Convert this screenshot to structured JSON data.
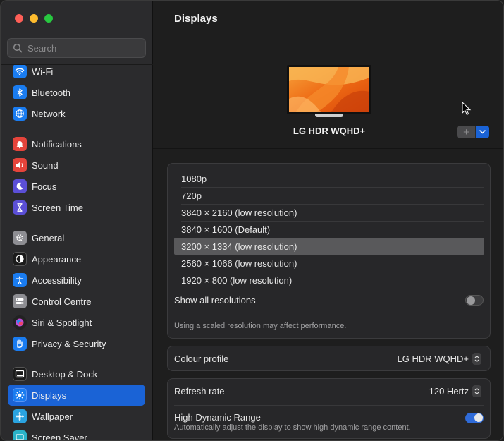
{
  "search": {
    "placeholder": "Search"
  },
  "sidebar": {
    "items": [
      {
        "label": "Wi-Fi",
        "icon": "wifi-icon",
        "color": "#1a7cf0"
      },
      {
        "label": "Bluetooth",
        "icon": "bluetooth-icon",
        "color": "#1a7cf0"
      },
      {
        "label": "Network",
        "icon": "globe-icon",
        "color": "#1a7cf0"
      },
      {
        "label": "Notifications",
        "icon": "bell-icon",
        "color": "#e5443b"
      },
      {
        "label": "Sound",
        "icon": "speaker-icon",
        "color": "#e5443b"
      },
      {
        "label": "Focus",
        "icon": "moon-icon",
        "color": "#5b4fd6"
      },
      {
        "label": "Screen Time",
        "icon": "hourglass-icon",
        "color": "#5b4fd6"
      },
      {
        "label": "General",
        "icon": "gear-icon",
        "color": "#8e8e93"
      },
      {
        "label": "Appearance",
        "icon": "appearance-icon",
        "color": "#1b1b1b"
      },
      {
        "label": "Accessibility",
        "icon": "accessibility-icon",
        "color": "#1a7cf0"
      },
      {
        "label": "Control Centre",
        "icon": "control-centre-icon",
        "color": "#8e8e93"
      },
      {
        "label": "Siri & Spotlight",
        "icon": "siri-icon",
        "color": "#222222"
      },
      {
        "label": "Privacy & Security",
        "icon": "hand-icon",
        "color": "#1a7cf0"
      },
      {
        "label": "Desktop & Dock",
        "icon": "dock-icon",
        "color": "#1b1b1b"
      },
      {
        "label": "Displays",
        "icon": "sun-icon",
        "color": "#1a7cf0",
        "active": true
      },
      {
        "label": "Wallpaper",
        "icon": "wallpaper-icon",
        "color": "#2aa3e0"
      },
      {
        "label": "Screen Saver",
        "icon": "screen-saver-icon",
        "color": "#2ab3c8"
      }
    ]
  },
  "main": {
    "title": "Displays",
    "display_name": "LG HDR WQHD+",
    "add_label": "+",
    "resolutions": [
      "1080p",
      "720p",
      "3840 × 2160 (low resolution)",
      "3840 × 1600 (Default)",
      "3200 × 1334 (low resolution)",
      "2560 × 1066 (low resolution)",
      "1920 × 800 (low resolution)"
    ],
    "selected_resolution": "3200 × 1334 (low resolution)",
    "show_all_label": "Show all resolutions",
    "show_all_on": false,
    "scaled_note": "Using a scaled resolution may affect performance.",
    "colour_profile_label": "Colour profile",
    "colour_profile_value": "LG HDR WQHD+",
    "refresh_rate_label": "Refresh rate",
    "refresh_rate_value": "120 Hertz",
    "hdr_label": "High Dynamic Range",
    "hdr_sub": "Automatically adjust the display to show high dynamic range content.",
    "hdr_on": true
  },
  "colors": {
    "accent": "#1a63d6",
    "window_bg": "#1e1e1e",
    "sidebar_bg": "#2b2b2d"
  }
}
